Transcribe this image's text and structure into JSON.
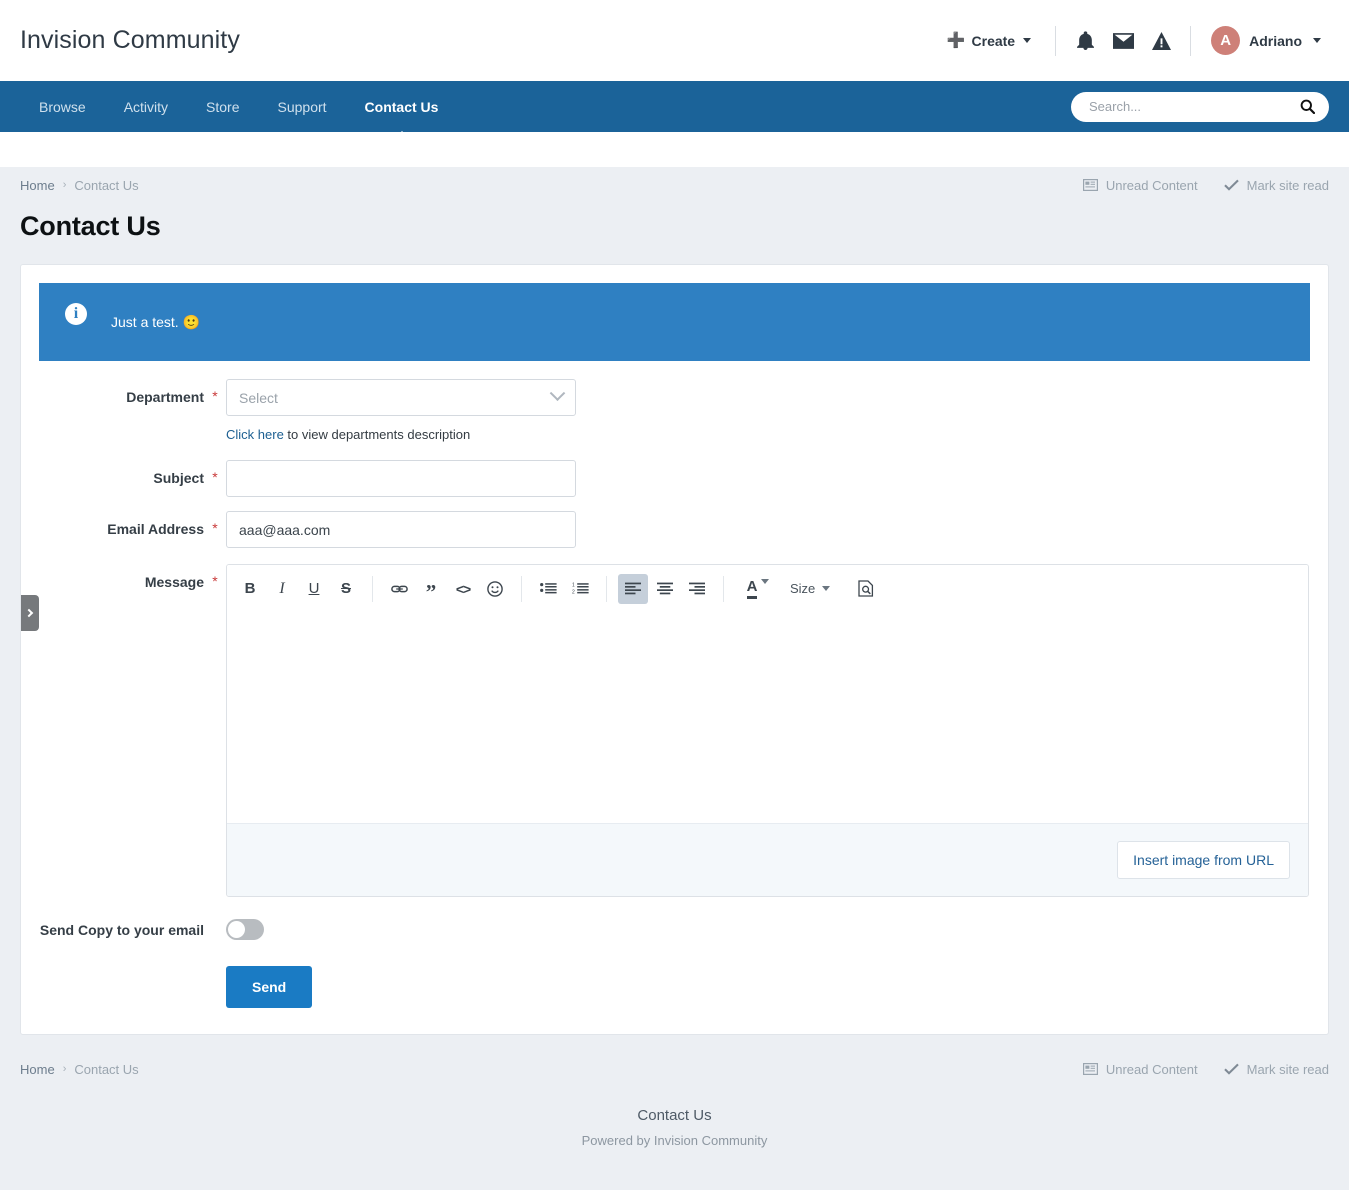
{
  "header": {
    "site_title": "Invision Community",
    "create_label": "Create",
    "create_icon": "plus-icon",
    "notifications_icon": "bell-icon",
    "messages_icon": "envelope-icon",
    "alerts_icon": "warning-triangle-icon",
    "avatar_initial": "A",
    "user_name": "Adriano",
    "avatar_color": "#ce8078"
  },
  "nav": {
    "items": [
      {
        "label": "Browse",
        "active": false
      },
      {
        "label": "Activity",
        "active": false
      },
      {
        "label": "Store",
        "active": false
      },
      {
        "label": "Support",
        "active": false
      },
      {
        "label": "Contact Us",
        "active": true
      }
    ],
    "background": "#1b6399",
    "search": {
      "placeholder": "Search...",
      "value": "",
      "icon": "search-icon"
    }
  },
  "breadcrumb": {
    "home": "Home",
    "separator": "›",
    "current": "Contact Us",
    "tools": [
      {
        "label": "Unread Content",
        "icon": "newspaper-icon"
      },
      {
        "label": "Mark site read",
        "icon": "check-icon"
      }
    ]
  },
  "page": {
    "title": "Contact Us"
  },
  "side_tab": {
    "icon": "chevron-right-icon"
  },
  "banner": {
    "icon": "info-circle-icon",
    "text": "Just a test. 🙂",
    "background": "#2f80c2"
  },
  "form": {
    "department": {
      "label": "Department",
      "required": "*",
      "placeholder": "Select",
      "value": "",
      "chevron_icon": "chevron-down-icon",
      "helper_link": "Click here",
      "helper_rest": " to view departments description"
    },
    "subject": {
      "label": "Subject",
      "required": "*",
      "value": "",
      "placeholder": ""
    },
    "email": {
      "label": "Email Address",
      "required": "*",
      "value": "aaa@aaa.com",
      "placeholder": ""
    },
    "message": {
      "label": "Message",
      "required": "*",
      "value": "",
      "toolbar": [
        {
          "name": "bold-icon",
          "label": "B",
          "active": false
        },
        {
          "name": "italic-icon",
          "label": "I",
          "active": false
        },
        {
          "name": "underline-icon",
          "label": "U",
          "active": false
        },
        {
          "name": "strikethrough-icon",
          "label": "S",
          "active": false
        },
        {
          "name": "link-icon",
          "label": "",
          "active": false
        },
        {
          "name": "quote-icon",
          "label": "”",
          "active": false
        },
        {
          "name": "code-icon",
          "label": "<>",
          "active": false
        },
        {
          "name": "emoji-icon",
          "label": "",
          "active": false
        },
        {
          "name": "bullet-list-icon",
          "label": "",
          "active": false
        },
        {
          "name": "numbered-list-icon",
          "label": "",
          "active": false
        },
        {
          "name": "align-left-icon",
          "label": "",
          "active": true
        },
        {
          "name": "align-center-icon",
          "label": "",
          "active": false
        },
        {
          "name": "align-right-icon",
          "label": "",
          "active": false
        },
        {
          "name": "text-color-icon",
          "label": "A",
          "active": false
        },
        {
          "name": "size-dropdown",
          "label": "Size",
          "active": false
        },
        {
          "name": "preview-source-icon",
          "label": "",
          "active": false
        }
      ],
      "insert_image_label": "Insert image from URL"
    },
    "send_copy": {
      "label": "Send Copy to your email",
      "checked": false
    },
    "send_button": {
      "label": "Send",
      "color": "#1a7bc4"
    }
  },
  "footer": {
    "home": "Home",
    "separator": "›",
    "current": "Contact Us",
    "tools": [
      {
        "label": "Unread Content",
        "icon": "newspaper-icon"
      },
      {
        "label": "Mark site read",
        "icon": "check-icon"
      }
    ],
    "title": "Contact Us",
    "powered_by": "Powered by Invision Community"
  }
}
